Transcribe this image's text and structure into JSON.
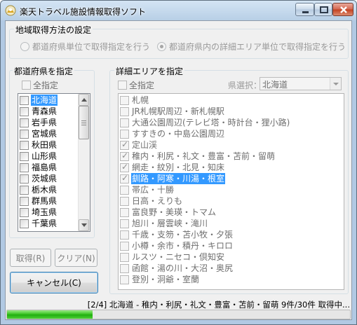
{
  "window": {
    "title": "楽天トラベル施設情報取得ソフト",
    "icon": "app-icon",
    "controls": [
      "minimize-icon",
      "maximize-icon",
      "close-icon"
    ]
  },
  "mode_group": {
    "title": "地域取得方法の設定",
    "options": [
      {
        "label": "都道府県単位で取得指定を行う",
        "selected": false
      },
      {
        "label": "都道府県内の詳細エリア単位で取得指定を行う",
        "selected": true
      }
    ]
  },
  "prefecture_group": {
    "title": "都道府県を指定",
    "check_all_label": "全指定",
    "items": [
      {
        "label": "北海道",
        "checked": false,
        "selected": true
      },
      {
        "label": "青森県",
        "checked": false,
        "selected": false
      },
      {
        "label": "岩手県",
        "checked": false,
        "selected": false
      },
      {
        "label": "宮城県",
        "checked": false,
        "selected": false
      },
      {
        "label": "秋田県",
        "checked": false,
        "selected": false
      },
      {
        "label": "山形県",
        "checked": false,
        "selected": false
      },
      {
        "label": "福島県",
        "checked": false,
        "selected": false
      },
      {
        "label": "茨城県",
        "checked": false,
        "selected": false
      },
      {
        "label": "栃木県",
        "checked": false,
        "selected": false
      },
      {
        "label": "群馬県",
        "checked": false,
        "selected": false
      },
      {
        "label": "埼玉県",
        "checked": false,
        "selected": false
      },
      {
        "label": "千葉県",
        "checked": false,
        "selected": false
      }
    ]
  },
  "area_group": {
    "title": "詳細エリアを指定",
    "check_all_label": "全指定",
    "pref_select_label": "県選択：",
    "pref_select_value": "北海道",
    "items": [
      {
        "label": "札幌",
        "checked": false,
        "selected": false
      },
      {
        "label": "JR札幌駅周辺・新札幌駅",
        "checked": false,
        "selected": false
      },
      {
        "label": "大通公園周辺(テレビ塔・時計台・狸小路)",
        "checked": false,
        "selected": false
      },
      {
        "label": "すすきの・中島公園周辺",
        "checked": false,
        "selected": false
      },
      {
        "label": "定山渓",
        "checked": true,
        "selected": false
      },
      {
        "label": "稚内・利尻・礼文・豊富・苫前・留萌",
        "checked": true,
        "selected": false
      },
      {
        "label": "網走・紋別・北見・知床",
        "checked": true,
        "selected": false
      },
      {
        "label": "釧路・阿寒・川湯・根室",
        "checked": true,
        "selected": true
      },
      {
        "label": "帯広・十勝",
        "checked": false,
        "selected": false
      },
      {
        "label": "日高・えりも",
        "checked": false,
        "selected": false
      },
      {
        "label": "富良野・美瑛・トマム",
        "checked": false,
        "selected": false
      },
      {
        "label": "旭川・層雲峡・滝川",
        "checked": false,
        "selected": false
      },
      {
        "label": "千歳・支笏・苫小牧・夕張",
        "checked": false,
        "selected": false
      },
      {
        "label": "小樽・余市・積丹・キロロ",
        "checked": false,
        "selected": false
      },
      {
        "label": "ルスツ・ニセコ・倶知安",
        "checked": false,
        "selected": false
      },
      {
        "label": "函館・湯の川・大沼・奥尻",
        "checked": false,
        "selected": false
      },
      {
        "label": "登別・洞爺・室蘭",
        "checked": false,
        "selected": false
      }
    ]
  },
  "buttons": {
    "fetch": "取得(R)",
    "clear": "クリア(N)",
    "cancel": "キャンセル(C)"
  },
  "status": {
    "text": "[2/4] 北海道 - 稚内・利尻・礼文・豊富・苫前・留萌 9件/30件 取得中...",
    "progress": 0.25
  }
}
